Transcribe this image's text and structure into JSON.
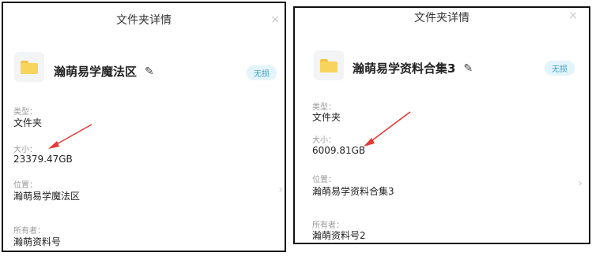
{
  "accent_color": "#e53935",
  "panels": [
    {
      "title": "文件夹详情",
      "close_glyph": "×",
      "folder_name": "瀚萌易学魔法区",
      "edit_glyph": "✎",
      "badge": "无损",
      "type_label": "类型：",
      "type_value": "文件夹",
      "size_label": "大小：",
      "size_value": "23379.47GB",
      "location_label": "位置：",
      "location_value": "瀚萌易学魔法区",
      "owner_label": "所有者：",
      "owner_value": "瀚萌资料号",
      "chevron_glyph": "›",
      "icons": [
        "folder-icon",
        "edit-icon",
        "close-icon",
        "chevron-right-icon",
        "arrow-annotation"
      ]
    },
    {
      "title": "文件夹详情",
      "close_glyph": "×",
      "folder_name": "瀚萌易学资料合集3",
      "edit_glyph": "✎",
      "badge": "无损",
      "type_label": "类型：",
      "type_value": "文件夹",
      "size_label": "大小：",
      "size_value": "6009.81GB",
      "location_label": "位置：",
      "location_value": "瀚萌易学资料合集3",
      "owner_label": "所有者：",
      "owner_value": "瀚萌资料号2",
      "chevron_glyph": "›",
      "icons": [
        "folder-icon",
        "edit-icon",
        "close-icon",
        "chevron-right-icon",
        "arrow-annotation"
      ]
    }
  ]
}
